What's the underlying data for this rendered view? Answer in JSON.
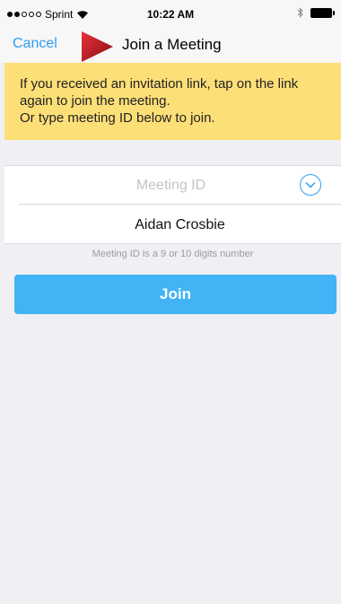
{
  "status_bar": {
    "carrier": "Sprint",
    "time": "10:22 AM",
    "icons": [
      "signal-dots-icon",
      "wifi-icon",
      "bluetooth-icon",
      "battery-icon"
    ]
  },
  "nav": {
    "cancel_label": "Cancel",
    "title": "Join a Meeting"
  },
  "banner": {
    "lines": [
      "If you received an invitation link, tap on the link",
      "again to join the meeting.",
      "Or type meeting ID below to join."
    ]
  },
  "form": {
    "meeting_id_placeholder": "Meeting ID",
    "meeting_id_value": "",
    "name_value": "Aidan Crosbie",
    "hint": "Meeting ID is a 9 or 10 digits number"
  },
  "join_label": "Join",
  "colors": {
    "accent": "#2d9df0",
    "join_button": "#42b3f5",
    "banner": "#fddf78",
    "pointer": "#d0121b"
  }
}
